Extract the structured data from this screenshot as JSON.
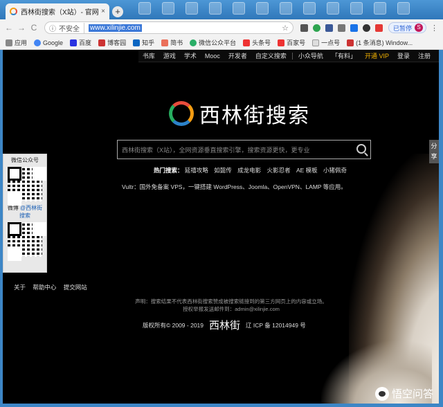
{
  "tab": {
    "title": "西林街搜索（X站）- 官网",
    "close": "×",
    "new": "+"
  },
  "toolbar": {
    "back": "←",
    "forward": "→",
    "reload": "C",
    "insecure": "不安全",
    "url": "www.xilinjie.com",
    "paused": "已暂停",
    "avatar": "S",
    "menu": "⋮"
  },
  "bookmarks": [
    "应用",
    "Google",
    "百度",
    "博客园",
    "知乎",
    "简书",
    "微信公众平台",
    "头条号",
    "百家号",
    "一点号",
    "(1 条消息) Window..."
  ],
  "topnav": [
    "书库",
    "游戏",
    "学术",
    "Mooc",
    "开发者",
    "自定义搜索",
    "小众导航",
    "「有料」",
    "开通 VIP",
    "登录",
    "注册"
  ],
  "logo": "西林街搜索",
  "search": {
    "placeholder": "西林街搜索（X站），全网资源垂直搜索引擎，搜索资源更快，更专业"
  },
  "hot": {
    "label": "热门搜索：",
    "items": [
      "延禧攻略",
      "如懿传",
      "成龙电影",
      "火影忍者",
      "AE 模板",
      "小猪佩奇"
    ]
  },
  "vultr": "Vultr：国外免备案 VPS，一键搭建 WordPress、Joomla、OpenVPN、LAMP 等应用。",
  "left_panel": {
    "wechat": "微信公众号",
    "weibo_label": "微博",
    "weibo_link": "@西林街",
    "weibo_link2": "搜索"
  },
  "left_links": [
    "关于",
    "帮助中心",
    "提交网站"
  ],
  "share": "分享",
  "notice": {
    "line1": "声明：搜索结果不代表西林街搜索赞成被搜索链接到的第三方网页上的内容或立场。",
    "line2": "授权举报发送邮件到：admin@xilinjie.com"
  },
  "copyright": {
    "left": "版权所有© 2009 - 2019",
    "brand": "西林街",
    "right": "辽 ICP 备 12014949 号"
  },
  "watermark": "悟空问答",
  "colors": {
    "vip": "#f5b301",
    "frame": "#3d86c6"
  }
}
